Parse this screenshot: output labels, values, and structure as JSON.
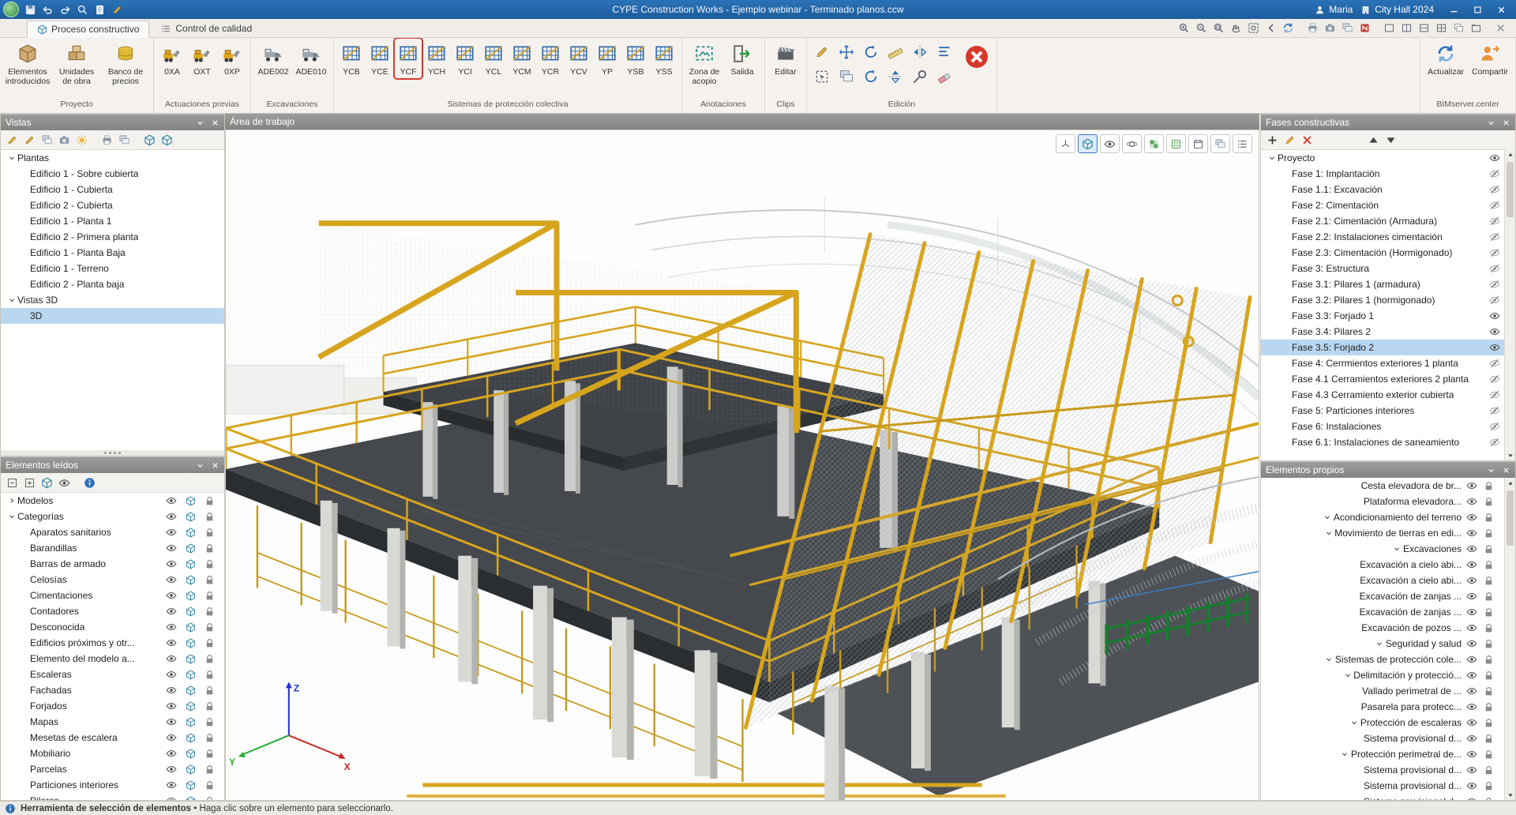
{
  "colors": {
    "titlebar": "#1d5c9c",
    "selection": "#b9d7f1",
    "highlight_red": "#d63b2f",
    "ribbon_bg": "#f5f2ee",
    "panel_header": "#8f8f8f",
    "steel_yellow": "#d7a51d",
    "status_bg": "#eceae6"
  },
  "title_bar": {
    "title": "CYPE Construction Works - Ejemplo webinar - Terminado planos.ccw",
    "user": "Maria",
    "project": "City Hall 2024",
    "quick_icons": [
      "save-icon",
      "undo-icon",
      "redo-icon",
      "zoomprev-icon",
      "doc-icon",
      "pencil-icon"
    ],
    "window_icons": [
      "minimize-icon",
      "maximize-icon",
      "close-icon"
    ]
  },
  "tabs": [
    {
      "label": "Proceso constructivo",
      "icon": "cube-icon",
      "active": true
    },
    {
      "label": "Control de calidad",
      "icon": "list-icon",
      "active": false
    }
  ],
  "tab_quick_icons": [
    "zoomin-icon",
    "zoomout-icon",
    "zoomwin-icon",
    "pan-icon",
    "zoomall-icon",
    "prevview-icon",
    "refresh-icon",
    "sep",
    "print-icon",
    "capture-icon",
    "layers-icon",
    "openbim-icon",
    "sep",
    "win1-icon",
    "winv-icon",
    "winh-icon",
    "wing-icon",
    "winc-icon",
    "wint-icon",
    "sep",
    "closeall-icon"
  ],
  "ribbon": {
    "groups": [
      {
        "label": "Proyecto",
        "btn_w": 58,
        "buttons": [
          {
            "label": "Elementos introducidos",
            "icon": "package"
          },
          {
            "label": "Unidades de obra",
            "icon": "boxes"
          },
          {
            "label": "Banco de precios",
            "icon": "coins"
          }
        ]
      },
      {
        "label": "Actuaciones previas",
        "btn_w": 34,
        "buttons": [
          {
            "label": "0XA",
            "icon": "machine"
          },
          {
            "label": "OXT",
            "icon": "machine"
          },
          {
            "label": "0XP",
            "icon": "machine"
          }
        ]
      },
      {
        "label": "Excavaciones",
        "btn_w": 44,
        "buttons": [
          {
            "label": "ADE002",
            "icon": "digger"
          },
          {
            "label": "ADE010",
            "icon": "digger"
          }
        ]
      },
      {
        "label": "Sistemas de protección colectiva",
        "btn_w": 32,
        "buttons": [
          {
            "label": "YCB",
            "icon": "net"
          },
          {
            "label": "YCE",
            "icon": "net"
          },
          {
            "label": "YCF",
            "icon": "net",
            "highlighted": true
          },
          {
            "label": "YCH",
            "icon": "net"
          },
          {
            "label": "YCI",
            "icon": "net"
          },
          {
            "label": "YCL",
            "icon": "net"
          },
          {
            "label": "YCM",
            "icon": "net"
          },
          {
            "label": "YCR",
            "icon": "net"
          },
          {
            "label": "YCV",
            "icon": "net"
          },
          {
            "label": "YP",
            "icon": "net"
          },
          {
            "label": "YSB",
            "icon": "net"
          },
          {
            "label": "YSS",
            "icon": "net"
          }
        ]
      },
      {
        "label": "Anotaciones",
        "btn_w": 44,
        "buttons": [
          {
            "label": "Zona de acopio",
            "icon": "zone"
          },
          {
            "label": "Salida",
            "icon": "exit"
          }
        ]
      },
      {
        "label": "Clips",
        "btn_w": 40,
        "buttons": [
          {
            "label": "Editar",
            "icon": "clip"
          }
        ]
      },
      {
        "label": "Edición",
        "icon_grid": [
          [
            "pencil",
            "move",
            "rotate",
            "ruler",
            "mirror",
            "align"
          ],
          [
            "select",
            "copy",
            "rotate2",
            "flipv",
            "modify",
            "eraser"
          ]
        ],
        "red_x": "redx"
      },
      {
        "label": "BIMserver.center",
        "btn_w": 52,
        "align_right": true,
        "buttons": [
          {
            "label": "Actualizar",
            "icon": "sync"
          },
          {
            "label": "Compartir",
            "icon": "share"
          }
        ]
      }
    ]
  },
  "vistas_panel": {
    "title": "Vistas",
    "toolbar_icons": [
      "pencil-icon",
      "pencil2-icon",
      "copy-icon",
      "camera-icon",
      "sun-icon",
      "sep",
      "print-icon",
      "layers-icon",
      "sep",
      "cube-icon",
      "cube2-icon"
    ],
    "tree": [
      {
        "label": "Plantas",
        "level": 0,
        "chev": "open"
      },
      {
        "label": "Edificio 1 - Sobre cubierta",
        "level": 1
      },
      {
        "label": "Edificio 1 - Cubierta",
        "level": 1
      },
      {
        "label": "Edificio 2 - Cubierta",
        "level": 1
      },
      {
        "label": "Edificio 1 - Planta 1",
        "level": 1
      },
      {
        "label": "Edificio 2 - Primera planta",
        "level": 1
      },
      {
        "label": "Edificio 1 - Planta Baja",
        "level": 1
      },
      {
        "label": "Edificio 1 - Terreno",
        "level": 1
      },
      {
        "label": "Edificio 2 - Planta baja",
        "level": 1
      },
      {
        "label": "Vistas 3D",
        "level": 0,
        "chev": "open"
      },
      {
        "label": "3D",
        "level": 1,
        "selected": true
      }
    ]
  },
  "leidos_panel": {
    "title": "Elementos leídos",
    "toolbar_icons": [
      "collapse-icon",
      "expand-icon",
      "cube-icon",
      "eye-icon",
      "sep",
      "info-icon"
    ],
    "tree": [
      {
        "label": "Modelos",
        "level": 0,
        "chev": "closed"
      },
      {
        "label": "Categorías",
        "level": 0,
        "chev": "open"
      },
      {
        "label": "Aparatos sanitarios",
        "level": 1
      },
      {
        "label": "Barandillas",
        "level": 1
      },
      {
        "label": "Barras de armado",
        "level": 1
      },
      {
        "label": "Celosías",
        "level": 1
      },
      {
        "label": "Cimentaciones",
        "level": 1
      },
      {
        "label": "Contadores",
        "level": 1
      },
      {
        "label": "Desconocida",
        "level": 1
      },
      {
        "label": "Edificios próximos y otr...",
        "level": 1
      },
      {
        "label": "Elemento del modelo a...",
        "level": 1
      },
      {
        "label": "Escaleras",
        "level": 1
      },
      {
        "label": "Fachadas",
        "level": 1
      },
      {
        "label": "Forjados",
        "level": 1
      },
      {
        "label": "Mapas",
        "level": 1
      },
      {
        "label": "Mesetas de escalera",
        "level": 1
      },
      {
        "label": "Mobiliario",
        "level": 1
      },
      {
        "label": "Parcelas",
        "level": 1
      },
      {
        "label": "Particiones interiores",
        "level": 1
      },
      {
        "label": "Pilares",
        "level": 1
      }
    ]
  },
  "workspace": {
    "title": "Área de trabajo",
    "overlay_icons": [
      "axis-icon",
      "iso-icon",
      "eye-icon",
      "orbit-icon",
      "tex-icon",
      "grid3-icon",
      "cal-icon",
      "layers2-icon",
      "list-icon"
    ],
    "overlay_active": "iso-icon",
    "axis": {
      "x": "X",
      "y": "Y",
      "z": "Z"
    }
  },
  "fases_panel": {
    "title": "Fases constructivas",
    "toolbar_icons": [
      "plus-icon",
      "pencil-icon",
      "xred-icon",
      "gap",
      "triU-icon",
      "triD-icon"
    ],
    "tree": [
      {
        "label": "Proyecto",
        "level": 0,
        "chev": "open",
        "vis": "eye"
      },
      {
        "label": "Fase 1: Implantación",
        "level": 1,
        "vis": "off"
      },
      {
        "label": "Fase 1.1: Excavación",
        "level": 1,
        "vis": "off"
      },
      {
        "label": "Fase 2: Cimentación",
        "level": 1,
        "vis": "off"
      },
      {
        "label": "Fase 2.1: Cimentación (Armadura)",
        "level": 1,
        "vis": "off"
      },
      {
        "label": "Fase 2.2: Instalaciones cimentación",
        "level": 1,
        "vis": "off"
      },
      {
        "label": "Fase 2.3: Cimentación (Hormigonado)",
        "level": 1,
        "vis": "off"
      },
      {
        "label": "Fase 3: Estructura",
        "level": 1,
        "vis": "off"
      },
      {
        "label": "Fase 3.1: Pilares 1 (armadura)",
        "level": 1,
        "vis": "off"
      },
      {
        "label": "Fase 3.2: Pilares 1 (hormigonado)",
        "level": 1,
        "vis": "off"
      },
      {
        "label": "Fase 3.3: Forjado 1",
        "level": 1,
        "vis": "eye"
      },
      {
        "label": "Fase 3.4: Pilares 2",
        "level": 1,
        "vis": "eye"
      },
      {
        "label": "Fase 3.5: Forjado 2",
        "level": 1,
        "vis": "eye",
        "selected": true
      },
      {
        "label": "Fase 4: Cerrmientos exteriores 1 planta",
        "level": 1,
        "vis": "off"
      },
      {
        "label": "Fase 4.1 Cerramientos exteriores 2 planta",
        "level": 1,
        "vis": "off"
      },
      {
        "label": "Fase 4.3 Cerramiento exterior cubierta",
        "level": 1,
        "vis": "off"
      },
      {
        "label": "Fase 5: Particiones interiores",
        "level": 1,
        "vis": "off"
      },
      {
        "label": "Fase 6: Instalaciones",
        "level": 1,
        "vis": "off"
      },
      {
        "label": "Fase 6.1: Instalaciones de saneamiento",
        "level": 1,
        "vis": "off"
      }
    ]
  },
  "propios_panel": {
    "title": "Elementos propios",
    "tree": [
      {
        "label": "Cesta elevadora de br...",
        "chev": false
      },
      {
        "label": "Plataforma elevadora...",
        "chev": false
      },
      {
        "label": "Acondicionamiento del terreno",
        "chev": true
      },
      {
        "label": "Movimiento de tierras en edi...",
        "chev": true
      },
      {
        "label": "Excavaciones",
        "chev": true
      },
      {
        "label": "Excavación a cielo abi...",
        "chev": false
      },
      {
        "label": "Excavación a cielo abi...",
        "chev": false
      },
      {
        "label": "Excavación de zanjas ...",
        "chev": false
      },
      {
        "label": "Excavación de zanjas ...",
        "chev": false
      },
      {
        "label": "Excavación de pozos ...",
        "chev": false
      },
      {
        "label": "Seguridad y salud",
        "chev": true
      },
      {
        "label": "Sistemas de protección cole...",
        "chev": true
      },
      {
        "label": "Delimitación y protecció...",
        "chev": true
      },
      {
        "label": "Vallado perimetral de ...",
        "chev": false
      },
      {
        "label": "Pasarela para protecc...",
        "chev": false
      },
      {
        "label": "Protección de escaleras",
        "chev": true
      },
      {
        "label": "Sistema provisional d...",
        "chev": false
      },
      {
        "label": "Protección perimetral de...",
        "chev": true
      },
      {
        "label": "Sistema provisional d...",
        "chev": false
      },
      {
        "label": "Sistema provisional d...",
        "chev": false
      },
      {
        "label": "Sistema provisional d...",
        "chev": false
      }
    ]
  },
  "status_bar": {
    "part1": "Herramienta de selección de elementos",
    "bullet": "•",
    "part2": "Haga clic sobre un elemento para seleccionarlo."
  }
}
